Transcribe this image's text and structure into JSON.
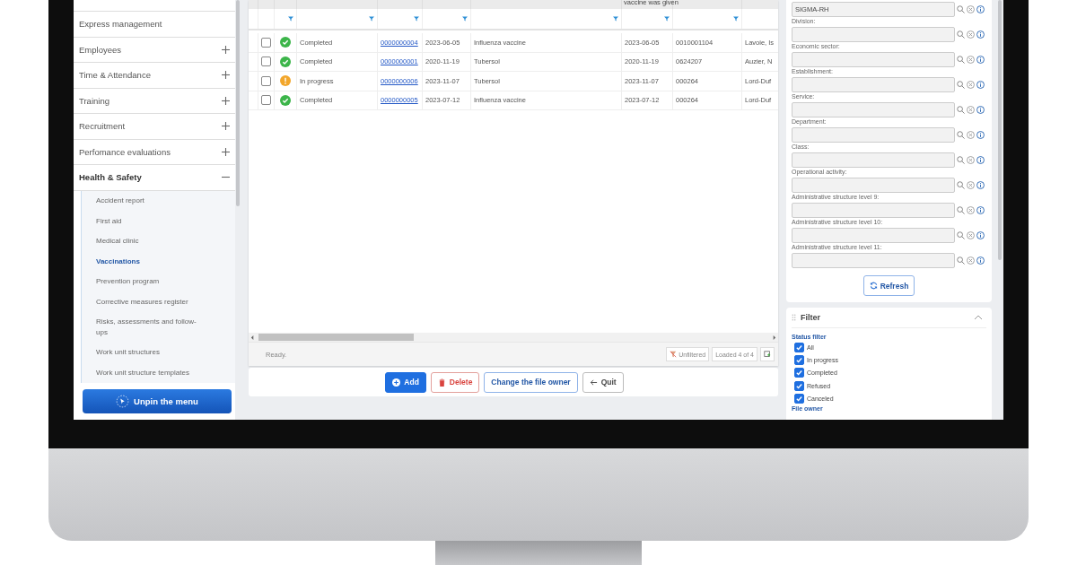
{
  "sidebar": {
    "items": [
      {
        "label": "Express management",
        "kind": "link"
      },
      {
        "label": "Employees",
        "kind": "group",
        "expanded": false
      },
      {
        "label": "Time & Attendance",
        "kind": "group",
        "expanded": false
      },
      {
        "label": "Training",
        "kind": "group",
        "expanded": false
      },
      {
        "label": "Recruitment",
        "kind": "group",
        "expanded": false
      },
      {
        "label": "Perfomance evaluations",
        "kind": "group",
        "expanded": false
      },
      {
        "label": "Health & Safety",
        "kind": "group",
        "expanded": true,
        "children": [
          {
            "label": "Accident report",
            "selected": false
          },
          {
            "label": "First aid",
            "selected": false
          },
          {
            "label": "Medical clinic",
            "selected": false
          },
          {
            "label": "Vaccinations",
            "selected": true
          },
          {
            "label": "Prevention program",
            "selected": false
          },
          {
            "label": "Corrective measures register",
            "selected": false
          },
          {
            "label": "Risks, assessments and follow-ups",
            "selected": false
          },
          {
            "label": "Work unit structures",
            "selected": false
          },
          {
            "label": "Work unit structure templates",
            "selected": false
          }
        ]
      }
    ],
    "unpin_button": "Unpin the menu"
  },
  "table": {
    "columns": [
      {
        "filterable": false
      },
      {
        "filterable": true
      },
      {
        "filterable": true
      },
      {
        "filterable": true
      },
      {
        "filterable": true
      },
      {
        "filterable": true
      },
      {
        "filterable": true,
        "header": "vaccine was given"
      },
      {
        "filterable": true
      },
      {
        "filterable": false
      }
    ],
    "rows": [
      {
        "checked": false,
        "kind": "completed",
        "status_description": "Completed",
        "event": "0000000004",
        "event_date": "2023-06-05",
        "vaccine": "Influenza vaccine",
        "date_given": "2023-06-05",
        "employee_id": "0010001104",
        "employee": "Lavoie, Is"
      },
      {
        "checked": false,
        "kind": "completed",
        "status_description": "Completed",
        "event": "0000000001",
        "event_date": "2020-11-19",
        "vaccine": "Tubersol",
        "date_given": "2020-11-19",
        "employee_id": "0624207",
        "employee": "Auzier, N"
      },
      {
        "checked": false,
        "kind": "in_progress",
        "status_description": "In progress",
        "event": "0000000006",
        "event_date": "2023-11-07",
        "vaccine": "Tubersol",
        "date_given": "2023-11-07",
        "employee_id": "000264",
        "employee": "Lord-Duf"
      },
      {
        "checked": false,
        "kind": "completed",
        "status_description": "Completed",
        "event": "0000000005",
        "event_date": "2023-07-12",
        "vaccine": "Influenza vaccine",
        "date_given": "2023-07-12",
        "employee_id": "000264",
        "employee": "Lord-Duf"
      }
    ],
    "status_bar": {
      "message": "Ready.",
      "filter_state": "Unfiltered",
      "count": "Loaded 4 of 4"
    }
  },
  "actions": [
    {
      "label": "Add",
      "kind": "primary"
    },
    {
      "label": "Delete",
      "kind": "danger"
    },
    {
      "label": "Change the file owner",
      "kind": "secondary"
    },
    {
      "label": "Quit",
      "kind": "back"
    }
  ],
  "structure_panel": {
    "fields": [
      {
        "value": "SIGMA-RH"
      },
      {
        "label": "Division:"
      },
      {
        "label": "Economic sector:"
      },
      {
        "label": "Establishment:"
      },
      {
        "label": "Service:"
      },
      {
        "label": "Department:"
      },
      {
        "label": "Class:"
      },
      {
        "label": "Operational activity:"
      },
      {
        "label": "Administrative structure level 9:"
      },
      {
        "label": "Administrative structure level 10:"
      },
      {
        "label": "Administrative structure level 11:"
      }
    ],
    "refresh_button": "Refresh"
  },
  "filter_panel": {
    "title": "Filter",
    "expanded": true,
    "group_label": "Status filter",
    "options": [
      {
        "label": "All",
        "checked": true
      },
      {
        "label": "In progress",
        "checked": true
      },
      {
        "label": "Completed",
        "checked": true
      },
      {
        "label": "Refused",
        "checked": true
      },
      {
        "label": "Canceled",
        "checked": true
      }
    ],
    "next_group_label": "File owner"
  }
}
